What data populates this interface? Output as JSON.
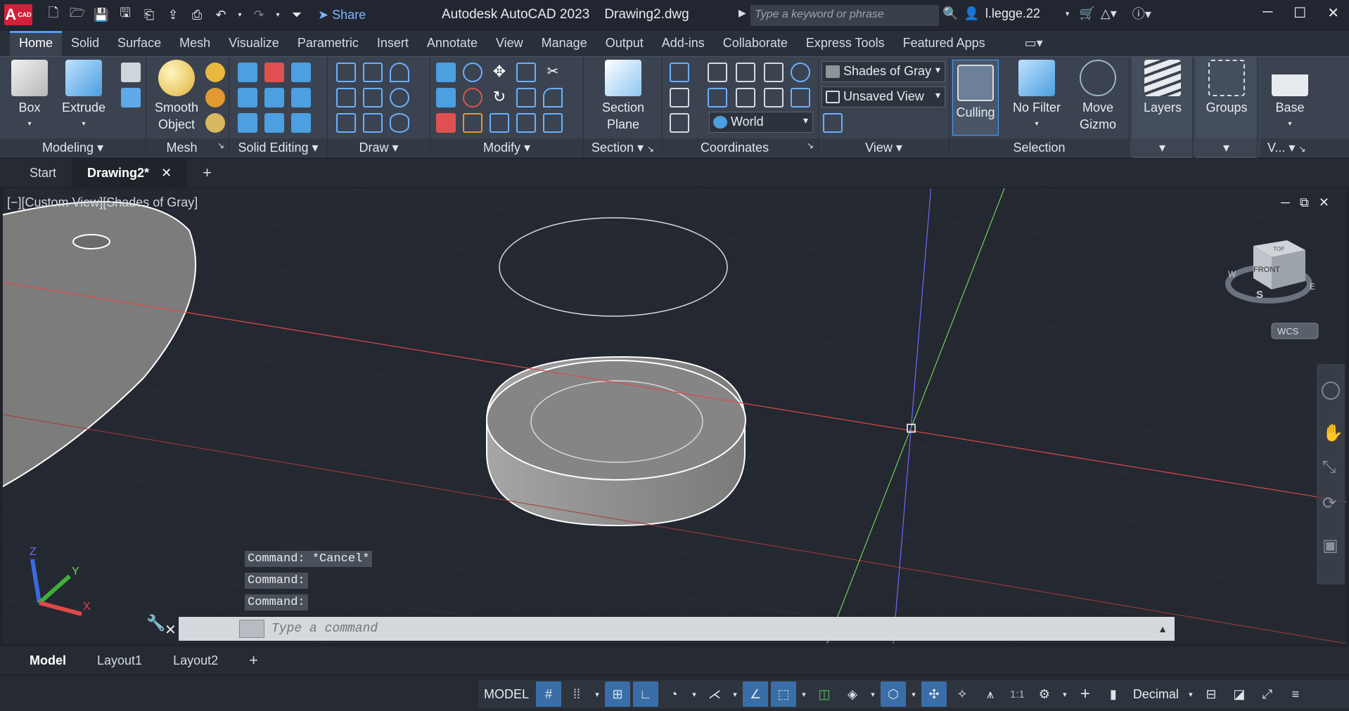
{
  "app": {
    "logo_text": "A",
    "logo_sub": "CAD",
    "title": "Autodesk AutoCAD 2023",
    "document": "Drawing2.dwg",
    "share_label": "Share"
  },
  "search": {
    "placeholder": "Type a keyword or phrase"
  },
  "user": {
    "name": "l.legge.22"
  },
  "ribbon_tabs": [
    "Home",
    "Solid",
    "Surface",
    "Mesh",
    "Visualize",
    "Parametric",
    "Insert",
    "Annotate",
    "View",
    "Manage",
    "Output",
    "Add-ins",
    "Collaborate",
    "Express Tools",
    "Featured Apps"
  ],
  "active_tab": "Home",
  "panels": {
    "modeling": {
      "label": "Modeling",
      "box": "Box",
      "extrude": "Extrude"
    },
    "mesh": {
      "label": "Mesh",
      "smooth": "Smooth\nObject"
    },
    "solid_editing": {
      "label": "Solid Editing"
    },
    "draw": {
      "label": "Draw"
    },
    "modify": {
      "label": "Modify"
    },
    "section": {
      "label": "Section",
      "plane": "Section\nPlane"
    },
    "coordinates": {
      "label": "Coordinates",
      "ucs": "World"
    },
    "view": {
      "label": "View",
      "visual_style": "Shades of Gray",
      "named_view": "Unsaved View"
    },
    "selection": {
      "label": "Selection",
      "culling": "Culling",
      "no_filter": "No Filter",
      "gizmo": "Move\nGizmo"
    },
    "layers": {
      "label": "Layers"
    },
    "groups": {
      "label": "Groups"
    },
    "base": {
      "label": "V...",
      "base": "Base"
    }
  },
  "doc_tabs": {
    "start": "Start",
    "active": "Drawing2*"
  },
  "viewport": {
    "label": "[−][Custom View][Shades of Gray]",
    "viewcube_top": "TOP",
    "viewcube_front": "FRONT",
    "compass_w": "W",
    "compass_e": "E",
    "compass_s": "S",
    "wcs": "WCS"
  },
  "ucs_icon": {
    "x": "X",
    "y": "Y",
    "z": "Z"
  },
  "command": {
    "history": [
      "Command: *Cancel*",
      "Command:",
      "Command:"
    ],
    "placeholder": "Type a command"
  },
  "layout_tabs": {
    "model": "Model",
    "layout1": "Layout1",
    "layout2": "Layout2"
  },
  "status": {
    "space": "MODEL",
    "scale": "1:1",
    "units": "Decimal"
  },
  "colors": {
    "accent": "#4a9eff",
    "logo": "#d0203a",
    "x_axis": "#e04848",
    "y_axis": "#6fd05a",
    "z_axis": "#6a6aff"
  }
}
